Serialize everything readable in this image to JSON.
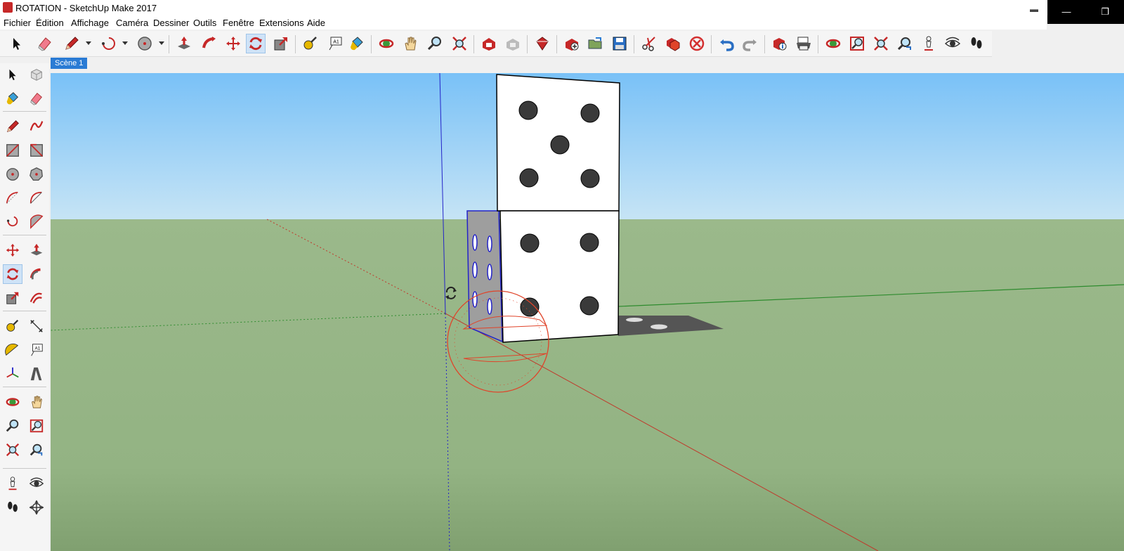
{
  "window": {
    "title": "ROTATION - SketchUp Make 2017"
  },
  "menu": [
    "Fichier",
    "Édition",
    "Affichage",
    "Caméra",
    "Dessiner",
    "Outils",
    "Fenêtre",
    "Extensions",
    "Aide"
  ],
  "window_controls": {
    "minimize": "—",
    "restore": "❐"
  },
  "scenes": {
    "active": "Scène 1"
  },
  "toolbar_labels": {
    "text_tool": "A1",
    "text_tool_left": "A1"
  },
  "colors": {
    "sky_top": "#79c1f7",
    "sky_bottom": "#c6e4f5",
    "ground_top": "#9bb98b",
    "ground_bottom": "#8aa87a",
    "accent_selection": "#2a7bd4",
    "axis_red": "#c0392b",
    "axis_green": "#2e8b2e",
    "axis_blue": "#2323c8",
    "protractor": "#e0442a",
    "dice_face": "#ffffff",
    "dice_pip": "#3a3a3a",
    "shadow": "#505050"
  },
  "tools": {
    "main_toolbar": [
      "select-icon",
      "eraser-icon",
      "pencil-icon",
      "arc-icon",
      "circle-icon",
      "push-pull-icon",
      "follow-me-icon",
      "move-icon",
      "rotate-icon",
      "scale-icon",
      "tape-measure-icon",
      "text-icon",
      "paint-bucket-icon",
      "orbit-icon",
      "pan-icon",
      "zoom-icon",
      "zoom-extents-icon",
      "warehouse-icon",
      "share-model-icon",
      "extension-warehouse-icon",
      "new-icon",
      "open-icon",
      "save-icon",
      "cut-icon",
      "copy-icon",
      "delete-icon",
      "undo-icon",
      "redo-icon",
      "model-info-icon",
      "print-icon",
      "orbit-icon-2",
      "zoom-window-icon",
      "zoom-extents-icon-2",
      "previous-view-icon",
      "position-camera-icon",
      "look-around-icon",
      "walk-icon"
    ],
    "left_toolbar": [
      "select-icon",
      "make-component-icon",
      "paint-bucket-icon",
      "eraser-icon",
      "line-icon",
      "freehand-icon",
      "rectangle-icon",
      "rotated-rectangle-icon",
      "circle-icon",
      "polygon-icon",
      "arc-icon",
      "two-point-arc-icon",
      "three-point-arc-icon",
      "pie-icon",
      "move-icon",
      "push-pull-icon",
      "rotate-icon",
      "follow-me-icon",
      "scale-icon",
      "offset-icon",
      "tape-measure-icon",
      "dimension-icon",
      "protractor-icon",
      "text-icon",
      "axes-icon",
      "3d-text-icon",
      "orbit-icon",
      "pan-icon",
      "zoom-icon",
      "zoom-window-icon",
      "zoom-extents-icon",
      "previous-view-icon",
      "position-camera-icon",
      "look-around-icon",
      "walk-icon",
      "section-plane-icon"
    ],
    "active": "rotate-icon"
  }
}
